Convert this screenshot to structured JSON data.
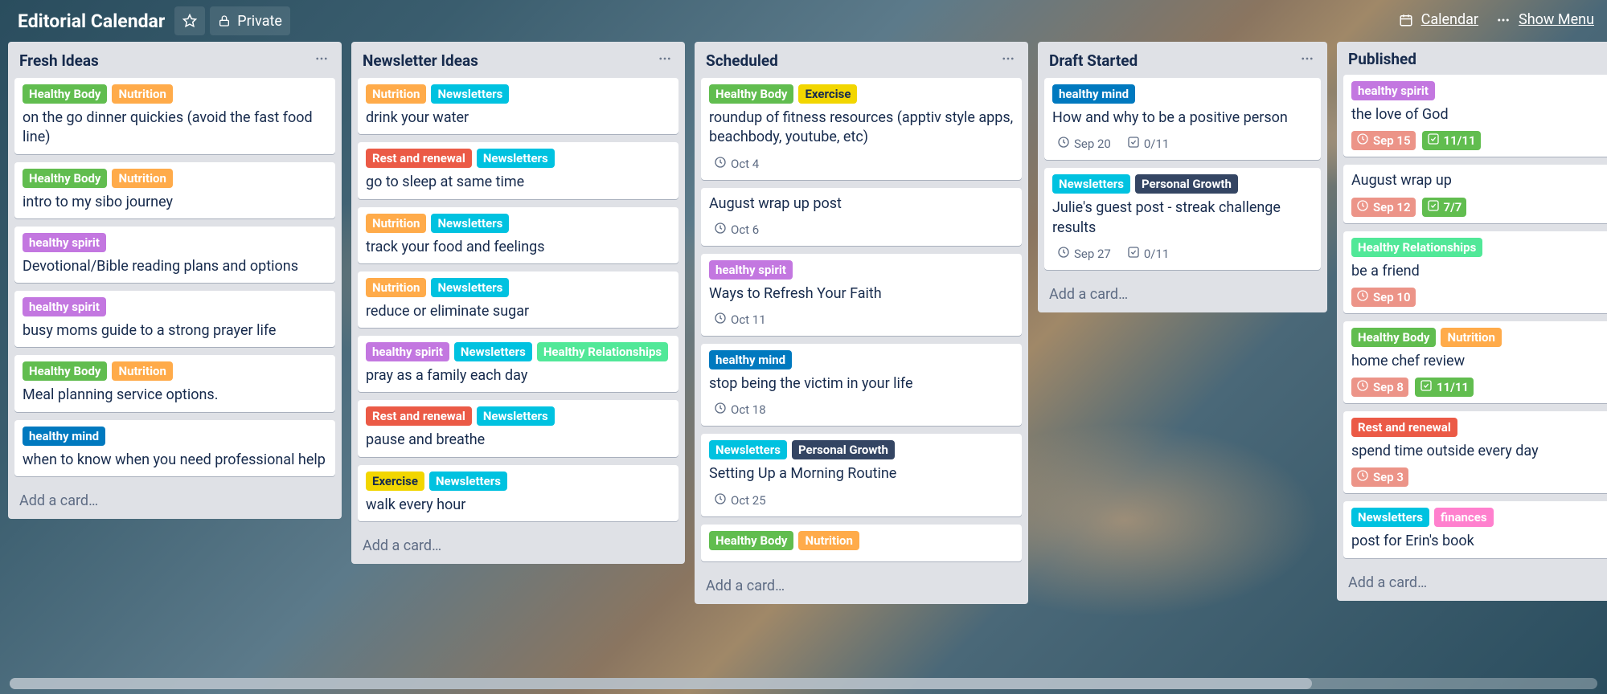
{
  "header": {
    "title": "Editorial Calendar",
    "privacy": "Private",
    "calendar_link": "Calendar",
    "show_menu": "Show Menu"
  },
  "label_colors": {
    "Healthy Body": "#61bd4f",
    "Nutrition": "#ffab4a",
    "healthy spirit": "#c377e0",
    "healthy mind": "#0079bf",
    "Rest and renewal": "#eb5a46",
    "Newsletters": "#00c2e0",
    "Healthy Relationships": "#51e898",
    "Exercise": "#f2d600",
    "Personal Growth": "#344563",
    "finances": "#ff80ce"
  },
  "add_card_text": "Add a card…",
  "lists": [
    {
      "title": "Fresh Ideas",
      "show_menu": true,
      "cards": [
        {
          "labels": [
            "Healthy Body",
            "Nutrition"
          ],
          "title": "on the go dinner quickies (avoid the fast food line)"
        },
        {
          "labels": [
            "Healthy Body",
            "Nutrition"
          ],
          "title": "intro to my sibo journey"
        },
        {
          "labels": [
            "healthy spirit"
          ],
          "title": "Devotional/Bible reading plans and options"
        },
        {
          "labels": [
            "healthy spirit"
          ],
          "title": "busy moms guide to a strong prayer life"
        },
        {
          "labels": [
            "Healthy Body",
            "Nutrition"
          ],
          "title": "Meal planning service options."
        },
        {
          "labels": [
            "healthy mind"
          ],
          "title": "when to know when you need professional help"
        }
      ]
    },
    {
      "title": "Newsletter Ideas",
      "show_menu": true,
      "cards": [
        {
          "labels": [
            "Nutrition",
            "Newsletters"
          ],
          "title": "drink your water"
        },
        {
          "labels": [
            "Rest and renewal",
            "Newsletters"
          ],
          "title": "go to sleep at same time"
        },
        {
          "labels": [
            "Nutrition",
            "Newsletters"
          ],
          "title": "track your food and feelings"
        },
        {
          "labels": [
            "Nutrition",
            "Newsletters"
          ],
          "title": "reduce or eliminate sugar"
        },
        {
          "labels": [
            "healthy spirit",
            "Newsletters",
            "Healthy Relationships"
          ],
          "title": "pray as a family each day"
        },
        {
          "labels": [
            "Rest and renewal",
            "Newsletters"
          ],
          "title": "pause and breathe"
        },
        {
          "labels": [
            "Exercise",
            "Newsletters"
          ],
          "title": "walk every hour"
        }
      ]
    },
    {
      "title": "Scheduled",
      "show_menu": true,
      "cards": [
        {
          "labels": [
            "Healthy Body",
            "Exercise"
          ],
          "title": "roundup of fitness resources (apptiv style apps, beachbody, youtube, etc)",
          "due": "Oct 4"
        },
        {
          "labels": [],
          "title": "August wrap up post",
          "due": "Oct 6"
        },
        {
          "labels": [
            "healthy spirit"
          ],
          "title": "Ways to Refresh Your Faith",
          "due": "Oct 11"
        },
        {
          "labels": [
            "healthy mind"
          ],
          "title": "stop being the victim in your life",
          "due": "Oct 18"
        },
        {
          "labels": [
            "Newsletters",
            "Personal Growth"
          ],
          "title": "Setting Up a Morning Routine",
          "due": "Oct 25"
        },
        {
          "labels": [
            "Healthy Body",
            "Nutrition"
          ],
          "title": ""
        }
      ]
    },
    {
      "title": "Draft Started",
      "show_menu": true,
      "narrow": true,
      "cards": [
        {
          "labels": [
            "healthy mind"
          ],
          "title": "How and why to be a positive person",
          "due": "Sep 20",
          "checklist": "0/11"
        },
        {
          "labels": [
            "Newsletters",
            "Personal Growth"
          ],
          "title": "Julie's guest post - streak challenge results",
          "due": "Sep 27",
          "checklist": "0/11"
        }
      ]
    },
    {
      "title": "Published",
      "show_menu": false,
      "cards": [
        {
          "labels": [
            "healthy spirit"
          ],
          "title": "the love of God",
          "due": "Sep 15",
          "due_past": true,
          "checklist": "11/11",
          "checklist_done": true
        },
        {
          "labels": [],
          "title": "August wrap up",
          "due": "Sep 12",
          "due_past": true,
          "checklist": "7/7",
          "checklist_done": true
        },
        {
          "labels": [
            "Healthy Relationships"
          ],
          "title": "be a friend",
          "due": "Sep 10",
          "due_past": true
        },
        {
          "labels": [
            "Healthy Body",
            "Nutrition"
          ],
          "title": "home chef review",
          "due": "Sep 8",
          "due_past": true,
          "checklist": "11/11",
          "checklist_done": true
        },
        {
          "labels": [
            "Rest and renewal"
          ],
          "title": "spend time outside every day",
          "due": "Sep 3",
          "due_past": true
        },
        {
          "labels": [
            "Newsletters",
            "finances"
          ],
          "title": "post for Erin's book"
        }
      ]
    }
  ]
}
